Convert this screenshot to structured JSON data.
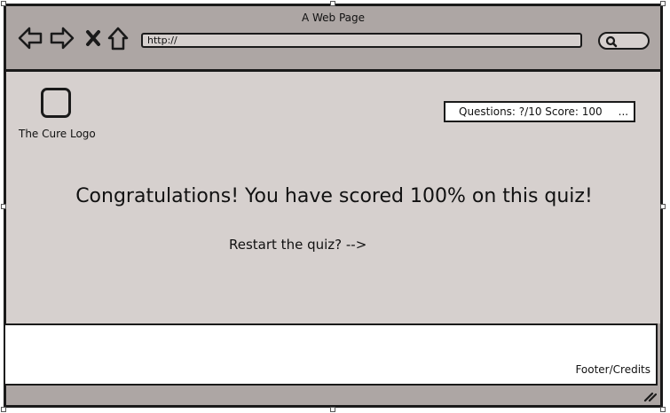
{
  "window": {
    "title": "A Web Page"
  },
  "toolbar": {
    "url_text": "http://",
    "icons": [
      "back-arrow-icon",
      "forward-arrow-icon",
      "close-icon",
      "home-icon",
      "search-icon"
    ]
  },
  "header": {
    "logo_label": "The Cure Logo",
    "status_text": "Questions: ?/10 Score: 100",
    "status_more": "..."
  },
  "main": {
    "headline": "Congratulations! You have scored 100% on this quiz!",
    "restart_link": "Restart the quiz? -->"
  },
  "footer": {
    "label": "Footer/Credits"
  },
  "colors": {
    "chrome": "#ada6a4",
    "content": "#d6d0ce",
    "border": "#1a1a1a"
  }
}
